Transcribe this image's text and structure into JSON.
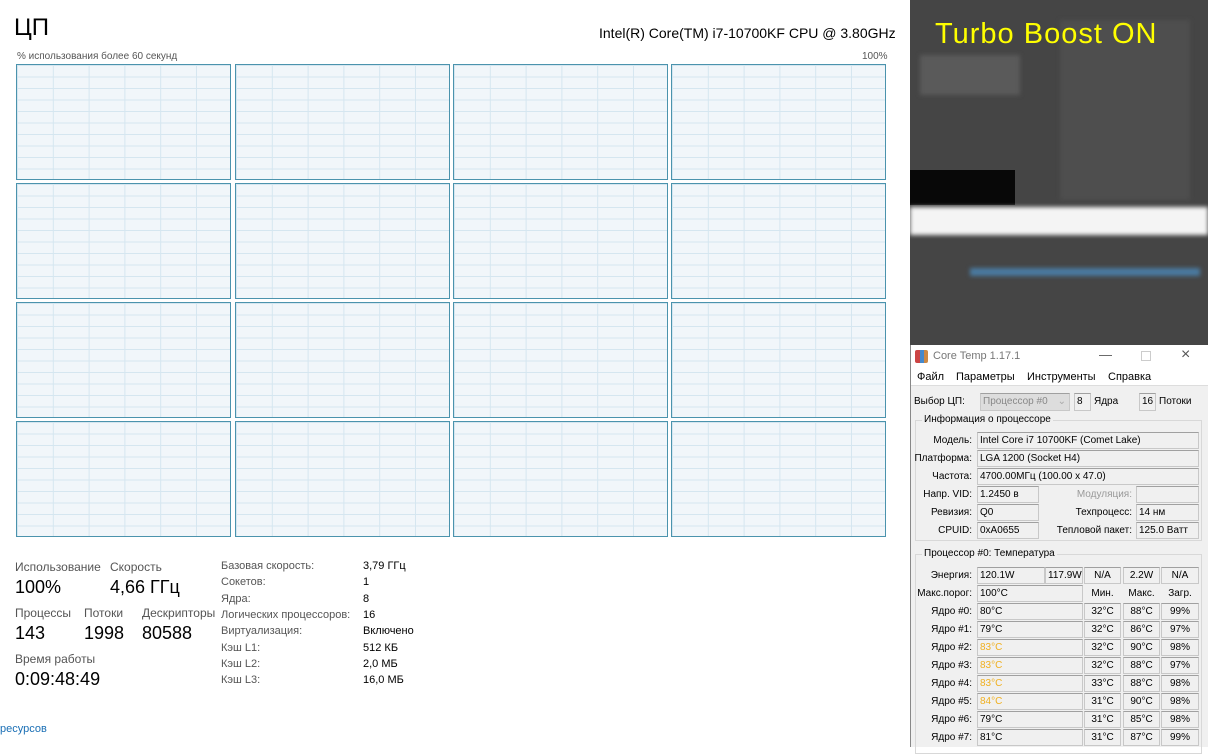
{
  "taskmgr": {
    "title": "ЦП",
    "cpu_name": "Intel(R) Core(TM) i7-10700KF CPU @ 3.80GHz",
    "graph_label": "% использования более 60 секунд",
    "graph_max": "100%",
    "logical_graphs": 16,
    "stats": {
      "usage_label": "Использование",
      "usage": "100%",
      "speed_label": "Скорость",
      "speed": "4,66 ГГц",
      "proc_label": "Процессы",
      "proc": "143",
      "threads_label": "Потоки",
      "threads": "1998",
      "handles_label": "Дескрипторы",
      "handles": "80588",
      "uptime_label": "Время работы",
      "uptime": "0:09:48:49"
    },
    "details": [
      {
        "k": "Базовая скорость:",
        "v": "3,79 ГГц"
      },
      {
        "k": "Сокетов:",
        "v": "1"
      },
      {
        "k": "Ядра:",
        "v": "8"
      },
      {
        "k": "Логических процессоров:",
        "v": "16"
      },
      {
        "k": "Виртуализация:",
        "v": "Включено"
      },
      {
        "k": "Кэш L1:",
        "v": "512 КБ"
      },
      {
        "k": "Кэш L2:",
        "v": "2,0 МБ"
      },
      {
        "k": "Кэш L3:",
        "v": "16,0 МБ"
      }
    ],
    "link": "ресурсов"
  },
  "overlay": {
    "turbo": "Turbo Boost ON",
    "color": "#ffff00"
  },
  "coretemp": {
    "title": "Core Temp 1.17.1",
    "menu": [
      "Файл",
      "Параметры",
      "Инструменты",
      "Справка"
    ],
    "cpu_sel_label": "Выбор ЦП:",
    "cpu_sel": "Процессор #0",
    "cores": "8",
    "cores_label": "Ядра",
    "threads": "16",
    "threads_label": "Потоки",
    "info_title": "Информация о процессоре",
    "model_l": "Модель:",
    "model": "Intel Core i7 10700KF (Comet Lake)",
    "platform_l": "Платформа:",
    "platform": "LGA 1200 (Socket H4)",
    "freq_l": "Частота:",
    "freq": "4700.00МГц (100.00 x 47.0)",
    "vid_l": "Напр. VID:",
    "vid": "1.2450 в",
    "mod_l": "Модуляция:",
    "mod": "",
    "rev_l": "Ревизия:",
    "rev": "Q0",
    "tech_l": "Техпроцесс:",
    "tech": "14 нм",
    "cpuid_l": "CPUID:",
    "cpuid": "0xA0655",
    "tdp_l": "Тепловой пакет:",
    "tdp": "125.0 Ватт",
    "temp_title": "Процессор #0: Температура",
    "power_l": "Энергия:",
    "power": [
      "120.1W",
      "117.9W",
      "N/A",
      "2.2W",
      "N/A"
    ],
    "tjmax_l": "Макс.порог:",
    "tjmax": "100°C",
    "h_min": "Мин.",
    "h_max": "Макс.",
    "h_load": "Загр.",
    "cores_t": [
      {
        "n": "Ядро #0:",
        "t": "80°C",
        "min": "32°C",
        "max": "88°C",
        "load": "99%",
        "hot": false
      },
      {
        "n": "Ядро #1:",
        "t": "79°C",
        "min": "32°C",
        "max": "86°C",
        "load": "97%",
        "hot": false
      },
      {
        "n": "Ядро #2:",
        "t": "83°C",
        "min": "32°C",
        "max": "90°C",
        "load": "98%",
        "hot": true
      },
      {
        "n": "Ядро #3:",
        "t": "83°C",
        "min": "32°C",
        "max": "88°C",
        "load": "97%",
        "hot": true
      },
      {
        "n": "Ядро #4:",
        "t": "83°C",
        "min": "33°C",
        "max": "88°C",
        "load": "98%",
        "hot": true
      },
      {
        "n": "Ядро #5:",
        "t": "84°C",
        "min": "31°C",
        "max": "90°C",
        "load": "98%",
        "hot": true
      },
      {
        "n": "Ядро #6:",
        "t": "79°C",
        "min": "31°C",
        "max": "85°C",
        "load": "98%",
        "hot": false
      },
      {
        "n": "Ядро #7:",
        "t": "81°C",
        "min": "31°C",
        "max": "87°C",
        "load": "99%",
        "hot": false
      }
    ]
  }
}
